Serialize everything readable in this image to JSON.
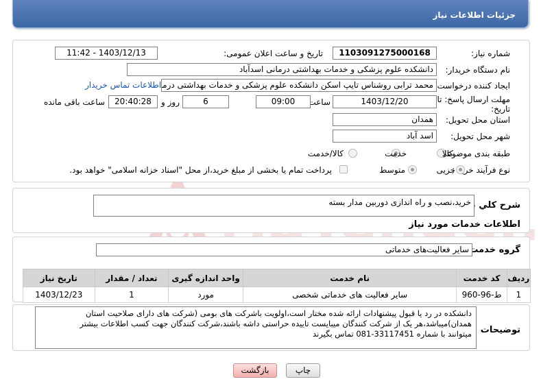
{
  "header": {
    "title": "جزئیات اطلاعات نیاز"
  },
  "form": {
    "need_number_label": "شماره نیاز:",
    "need_number": "1103091275000168",
    "announce_label": "تاریخ و ساعت اعلان عمومی:",
    "announce_value": "1403/12/13 - 11:42",
    "buyer_org_label": "نام دستگاه خریدار:",
    "buyer_org": "دانشکده علوم پزشکی و خدمات بهداشتی درمانی اسدآباد",
    "creator_label": "ایجاد کننده درخواست:",
    "creator": "محمد ترابی روشناس تایپ اسکن دانشکده علوم پزشکی و خدمات بهداشتی درمانی اسدآباد",
    "contact_link": "اطلاعات تماس خریدار",
    "deadline_label_1": "مهلت ارسال پاسخ: تا",
    "deadline_label_2": "تاریخ:",
    "deadline_date": "1403/12/20",
    "time_label": "ساعت",
    "deadline_time": "09:00",
    "days_value": "6",
    "days_label": "روز و",
    "remaining_time": "20:40:28",
    "remaining_label": "ساعت باقی مانده",
    "province_label": "استان محل تحویل:",
    "province": "همدان",
    "city_label": "شهر محل تحویل:",
    "city": "اسد آباد",
    "category_label": "طبقه بندی موضوعی:",
    "category_options": [
      "کالا",
      "خدمت",
      "کالا/خدمت"
    ],
    "category_selected": "خدمت",
    "process_label": "نوع فرآیند خرید :",
    "process_options": [
      "جزیی",
      "متوسط"
    ],
    "process_selected": "جزیی",
    "payment_note": "پرداخت تمام یا بخشی از مبلغ خرید،از محل \"اسناد خزانه اسلامی\" خواهد بود."
  },
  "summary": {
    "label": "شرح کلي نياز:",
    "value": "خرید،نصب و راه اندازی دوربین مدار بسته"
  },
  "services": {
    "section_title": "اطلاعات خدمات مورد نیاز",
    "group_label": "گروه خدمت:",
    "group_value": "سایر فعالیت‌های خدماتی",
    "columns": [
      "ردیف",
      "کد خدمت",
      "نام خدمت",
      "واحد اندازه گیری",
      "تعداد / مقدار",
      "تاریخ نیاز"
    ],
    "rows": [
      [
        "1",
        "ط-96-960",
        "سایر فعالیت های خدماتی شخصی",
        "مورد",
        "1",
        "1403/12/23"
      ]
    ]
  },
  "notes": {
    "label": "توضیحات خریدار:",
    "line1": "دانشکده در رد یا قبول پیشنهادات ارائه شده مختار است،اولویت باشرکت های بومی (شرکت های دارای صلاحیت استان",
    "line2": "همدان)میباشد،هر یک از شرکت کنندگان میبایست تاییده حراستی داشه باشند،شرکت کنندگان جهت کسب اطلاعات بیشتر",
    "line3": "میتوانند با شماره  33117451-081 تماس بگیرند"
  },
  "buttons": {
    "print": "چاپ",
    "back": "بازگشت"
  },
  "watermark": {
    "text": "AriaTender.neT"
  },
  "colors": {
    "header": "#4a73b1",
    "link": "#1a55b0",
    "watermark": "#e9b3b3"
  }
}
